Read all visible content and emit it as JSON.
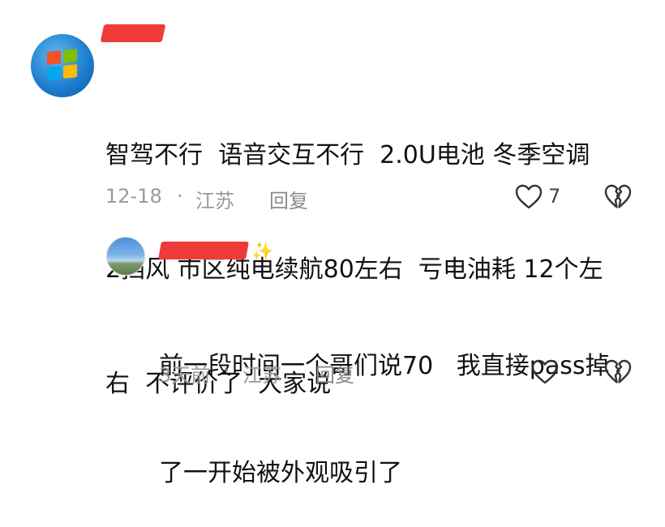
{
  "comment": {
    "author_name": "",
    "text_lines": [
      "智驾不行  语音交互不行  2.0U电池 冬季空调",
      "2挡风 市区纯电续航80左右  亏电油耗 12个左",
      "右  不评价了  大家说"
    ],
    "date": "12-18",
    "separator": "·",
    "location": "江苏",
    "reply_label": "回复",
    "like_count": "7"
  },
  "reply": {
    "author_name": "",
    "text_lines": [
      "前一段时间一个哥们说70   我直接pass掉",
      "了一开始被外观吸引了"
    ],
    "date": "3天前",
    "separator": "·",
    "location": "江苏",
    "reply_label": "回复"
  },
  "icons": {
    "like": "heart-outline-icon",
    "dislike": "broken-heart-icon"
  },
  "colors": {
    "redaction": "#f03a3a",
    "meta_text": "#9a9a9a"
  }
}
